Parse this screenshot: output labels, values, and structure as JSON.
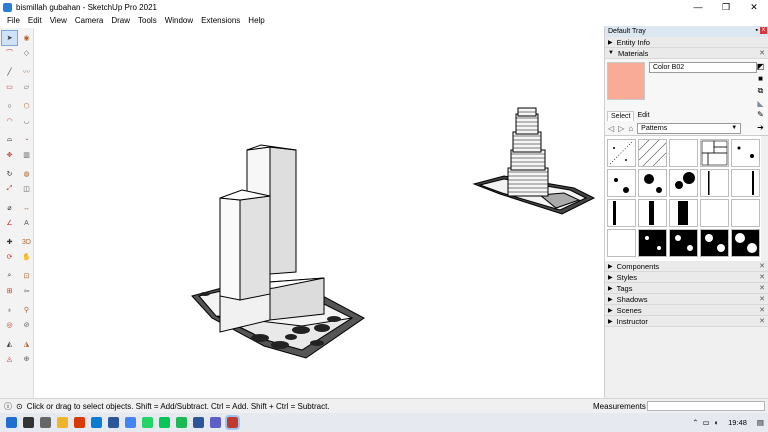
{
  "window": {
    "title": "bismillah gubahan - SketchUp Pro 2021",
    "minimize": "—",
    "maximize": "❐",
    "close": "✕"
  },
  "menu": [
    "File",
    "Edit",
    "View",
    "Camera",
    "Draw",
    "Tools",
    "Window",
    "Extensions",
    "Help"
  ],
  "tools": [
    "select",
    "paint-bucket",
    "lasso",
    "eraser",
    "line",
    "freehand",
    "rectangle",
    "rotated-rectangle",
    "circle",
    "polygon",
    "arc",
    "2pt-arc",
    "3pt-arc",
    "pie",
    "move",
    "push-pull",
    "rotate",
    "follow-me",
    "scale",
    "offset",
    "tape-measure",
    "dimension",
    "protractor",
    "text",
    "axes",
    "3d-text",
    "orbit",
    "pan",
    "zoom",
    "zoom-window",
    "zoom-extents",
    "previous",
    "position-camera",
    "walk",
    "look-around",
    "section-plane",
    "sandbox-from-contours",
    "sandbox-from-scratch",
    "smoove",
    "stamp"
  ],
  "tray": {
    "title": "Default Tray",
    "pin": "▪",
    "close": "x",
    "entity_info": "Entity Info",
    "materials": "Materials",
    "material_name": "Color B02",
    "swatch_color": "#f9ab97",
    "tabs": [
      "Select",
      "Edit"
    ],
    "library": "Patterns",
    "collapsed_panels": [
      "Components",
      "Styles",
      "Tags",
      "Shadows",
      "Scenes",
      "Instructor"
    ]
  },
  "status": {
    "hint": "Click or drag to select objects. Shift = Add/Subtract. Ctrl = Add. Shift + Ctrl = Subtract.",
    "measurements_label": "Measurements"
  },
  "taskbar": {
    "time": "19:48",
    "apps": [
      "windows-start",
      "search",
      "task-view",
      "file-explorer",
      "office",
      "edge",
      "word-blue",
      "chrome",
      "whatsapp",
      "line",
      "spotify",
      "word",
      "teams",
      "sketchup"
    ]
  }
}
